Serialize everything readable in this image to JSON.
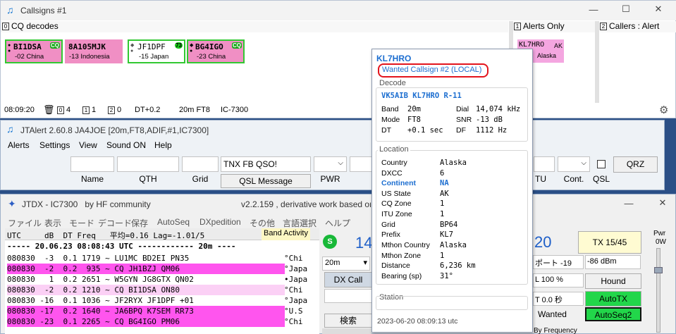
{
  "callsigns_window": {
    "title": "Callsigns #1",
    "panels": {
      "cq": {
        "badge": "0",
        "label": "CQ decodes"
      },
      "alerts": {
        "badge": "1",
        "label": "Alerts Only"
      },
      "callers": {
        "badge": "2",
        "label": "Callers : Alert"
      }
    },
    "tiles": [
      {
        "call": "BI1DSA",
        "sub": "-02 China",
        "tag": "CQ"
      },
      {
        "call": "8A105MJK",
        "sub": "-13 Indonesia",
        "tag": ""
      },
      {
        "call": "JF1DPF",
        "sub": "-15 Japan",
        "tag": "73"
      },
      {
        "call": "BG4IGO",
        "sub": "-23 China",
        "tag": "CQ"
      }
    ],
    "alert_tile": {
      "call": "KL7HRO",
      "tag": "AK",
      "sub": "Alaska"
    },
    "status": {
      "time": "08:09:20",
      "c0": "4",
      "c1": "1",
      "c2": "0",
      "dt": "DT+0.2",
      "mode": "20m FT8",
      "rig": "IC-7300"
    }
  },
  "jtalert_window": {
    "title": "JTAlert 2.60.8 JA4JOE [20m,FT8,ADIF,#1,IC7300]",
    "menu": [
      "Alerts",
      "Settings",
      "View",
      "Sound ON",
      "Help"
    ],
    "labels": {
      "name": "Name",
      "qth": "QTH",
      "grid": "Grid",
      "pwr": "PWR",
      "itu": "TU",
      "cont": "Cont.",
      "qsl": "QSL"
    },
    "comment_value": "TNX FB QSO!",
    "qsl_button": "QSL Message",
    "qrz_button": "QRZ"
  },
  "jtdx_window": {
    "title": "JTDX - IC7300   by HF community",
    "title_right": "v2.2.159 , derivative work based on",
    "menu": [
      "ファイル",
      "表示",
      "モード",
      "デコード",
      "保存",
      "AutoSeq",
      "DXpedition",
      "その他",
      "言語選択",
      "ヘルプ"
    ],
    "header": "UTC     dB  DT Freq   平均=0.16 Lag=-1.01/5",
    "band_activity": "Band Activity",
    "separator": "----- 20.06.23 08:08:43 UTC ------------ 20m ----",
    "rows": [
      {
        "text": "080830  -3  0.1 1719 ~ LU1MC BD2EI PN35",
        "note": "°Chi",
        "hl": false
      },
      {
        "text": "080830  -2  0.2  935 ~ CQ JH1BZJ QM06",
        "note": "°Japa",
        "hl": true
      },
      {
        "text": "080830   1  0.2 2651 ~ W5GYN JG8GTX QN02",
        "note": "•Japa",
        "hl": false
      },
      {
        "text": "080830  -2  0.2 1210 ~ CQ BI1DSA ON80",
        "note": "°Chi",
        "hl": true
      },
      {
        "text": "080830 -16  0.1 1036 ~ JF2RYX JF1DPF +01",
        "note": "°Japa",
        "hl": false
      },
      {
        "text": "080830 -17  0.2 1640 ~ JA6BPQ K7SEM RR73",
        "note": "°U.S",
        "hl": true
      },
      {
        "text": "080830 -23  0.1 2265 ~ CQ BG4IGO PM06",
        "note": "°Chi",
        "hl": true
      }
    ],
    "band_select": "20m",
    "dx_call": "DX Call",
    "search": "検索",
    "big_freq_left": "14",
    "big_freq_right": "20",
    "s_icon": "S",
    "pwr_label": "Pwr",
    "pwr_value": "0W",
    "report": "ポート -19",
    "dbm": "-86 dBm",
    "percent": "L  100 %",
    "time_select": "T 0.0 秒",
    "wanted": "Wanted",
    "tx_button": "TX 15/45",
    "hound_button": "Hound",
    "autotx_button": "AutoTX",
    "autoseq_button": "AutoSeq2",
    "by_freq": "By Frequency"
  },
  "popup": {
    "callsign": "KL7HRO",
    "wanted": "Wanted Callsign #2 (LOCAL)",
    "decode_label": "Decode",
    "decode_line": "VK5AIB KL7HRO R-11",
    "decode_fields": [
      {
        "k": "Band",
        "v": "20m",
        "k2": "Dial",
        "v2": "14,074 kHz"
      },
      {
        "k": "Mode",
        "v": "FT8",
        "k2": "SNR",
        "v2": "-13 dB"
      },
      {
        "k": "DT",
        "v": "+0.1 sec",
        "k2": "DF",
        "v2": "1112 Hz"
      }
    ],
    "location_label": "Location",
    "location_fields": [
      {
        "k": "Country",
        "v": "Alaska"
      },
      {
        "k": "DXCC",
        "v": "6"
      },
      {
        "k": "Continent",
        "v": "NA"
      },
      {
        "k": "US State",
        "v": "AK"
      },
      {
        "k": "CQ Zone",
        "v": "1"
      },
      {
        "k": "ITU Zone",
        "v": "1"
      },
      {
        "k": "Grid",
        "v": "BP64"
      },
      {
        "k": "Prefix",
        "v": "KL7"
      },
      {
        "k": "Mthon Country",
        "v": "Alaska"
      },
      {
        "k": "Mthon Zone",
        "v": "1"
      },
      {
        "k": "Distance",
        "v": "6,236 km"
      },
      {
        "k": "Bearing (sp)",
        "v": "31°"
      }
    ],
    "station_label": "Station",
    "timestamp": "2023-06-20 08:09:13 utc"
  },
  "colors": {
    "accent": "#1c6ed0",
    "highlight": "#ff55ee",
    "tile": "#f08fc4",
    "tile_border": "#32c832",
    "green_button": "#22d64a",
    "wanted_ring": "#e3141c"
  }
}
